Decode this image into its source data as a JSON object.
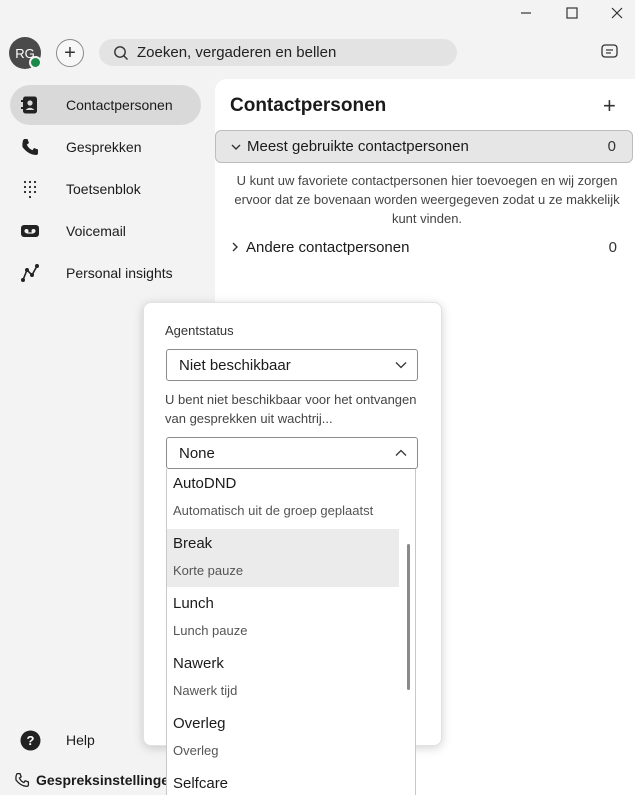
{
  "window": {
    "minimize_icon": "minimize-icon",
    "maximize_icon": "maximize-icon",
    "close_icon": "close-icon"
  },
  "header": {
    "avatar_initials": "RG",
    "presence_color": "#1a8a4b",
    "search_placeholder": "Zoeken, vergaderen en bellen"
  },
  "sidebar": {
    "items": [
      {
        "label": "Contactpersonen",
        "icon": "contacts-icon"
      },
      {
        "label": "Gesprekken",
        "icon": "phone-icon"
      },
      {
        "label": "Toetsenblok",
        "icon": "keypad-icon"
      },
      {
        "label": "Voicemail",
        "icon": "voicemail-icon"
      },
      {
        "label": "Personal insights",
        "icon": "insights-icon"
      }
    ],
    "help_label": "Help",
    "call_settings_label": "Gespreksinstellingen"
  },
  "main": {
    "title": "Contactpersonen",
    "groups": [
      {
        "name": "Meest gebruikte contactpersonen",
        "count": "0"
      },
      {
        "name": "Andere contactpersonen",
        "count": "0"
      }
    ],
    "info": "U kunt uw favoriete contactpersonen hier toevoegen en wij zorgen ervoor dat ze bovenaan worden weergegeven zodat u ze makkelijk kunt vinden."
  },
  "agent_status": {
    "label": "Agentstatus",
    "status_value": "Niet beschikbaar",
    "description": "U bent niet beschikbaar voor het ontvangen van gesprekken uit wachtrij...",
    "reason_value": "None",
    "options": [
      {
        "title": "AutoDND",
        "subtitle": "Automatisch uit de groep geplaatst"
      },
      {
        "title": "Break",
        "subtitle": "Korte pauze"
      },
      {
        "title": "Lunch",
        "subtitle": "Lunch pauze"
      },
      {
        "title": "Nawerk",
        "subtitle": "Nawerk tijd"
      },
      {
        "title": "Overleg",
        "subtitle": "Overleg"
      },
      {
        "title": "Selfcare",
        "subtitle": ""
      }
    ]
  }
}
